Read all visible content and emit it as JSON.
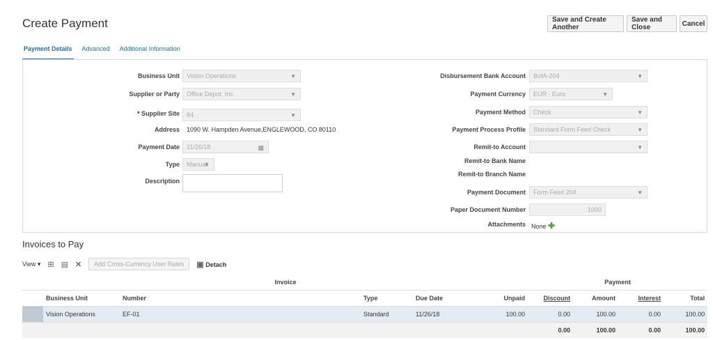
{
  "header": {
    "title": "Create Payment",
    "buttons": {
      "save_create_another": "Save and Create Another",
      "save_close": "Save and Close",
      "cancel": "Cancel"
    }
  },
  "tabs": [
    {
      "label": "Payment Details",
      "active": true
    },
    {
      "label": "Advanced",
      "active": false
    },
    {
      "label": "Additional Information",
      "active": false
    }
  ],
  "form_left": {
    "business_unit": {
      "label": "Business Unit",
      "value": "Vision Operations"
    },
    "supplier_party": {
      "label": "Supplier or Party",
      "value": "Office Depot, Inc"
    },
    "supplier_site": {
      "label": "Supplier Site",
      "required_mark": "*",
      "value": "84"
    },
    "address": {
      "label": "Address",
      "value": "1090 W. Hampden Avenue,ENGLEWOOD, CO 80110"
    },
    "payment_date": {
      "label": "Payment Date",
      "value": "11/26/18"
    },
    "type": {
      "label": "Type",
      "value": "Manual"
    },
    "description": {
      "label": "Description",
      "value": ""
    }
  },
  "form_right": {
    "disbursement_bank_account": {
      "label": "Disbursement Bank Account",
      "value": "BofA-204"
    },
    "payment_currency": {
      "label": "Payment Currency",
      "value": "EUR - Euro"
    },
    "payment_method": {
      "label": "Payment Method",
      "value": "Check"
    },
    "payment_process_profile": {
      "label": "Payment Process Profile",
      "value": "Standard Form Feed Check"
    },
    "remit_to_account": {
      "label": "Remit-to Account",
      "value": ""
    },
    "remit_to_bank_name": {
      "label": "Remit-to Bank Name"
    },
    "remit_to_branch_name": {
      "label": "Remit-to Branch Name"
    },
    "payment_document": {
      "label": "Payment Document",
      "value": "Form Feed 204"
    },
    "paper_document_number": {
      "label": "Paper Document Number",
      "value": "1000"
    },
    "attachments": {
      "label": "Attachments",
      "value": "None"
    }
  },
  "invoices": {
    "title": "Invoices to Pay",
    "toolbar": {
      "view_label": "View",
      "add_rates_label": "Add Cross-Currency User Rates",
      "detach_label": "Detach"
    },
    "group_headers": {
      "invoice": "Invoice",
      "payment": "Payment"
    },
    "columns": [
      "Business Unit",
      "Number",
      "Type",
      "Due Date",
      "Unpaid",
      "Discount",
      "Amount",
      "Interest",
      "Total"
    ],
    "rows": [
      {
        "business_unit": "Vision Operations",
        "number": "EF-01",
        "type": "Standard",
        "due_date": "11/26/18",
        "unpaid": "100.00",
        "discount": "0.00",
        "amount": "100.00",
        "interest": "0.00",
        "total": "100.00"
      }
    ],
    "totals": {
      "discount": "0.00",
      "amount": "100.00",
      "interest": "0.00",
      "total": "100.00"
    }
  },
  "colors": {
    "accent": "#1f6fb3",
    "row_highlight": "#e3ecf5"
  }
}
